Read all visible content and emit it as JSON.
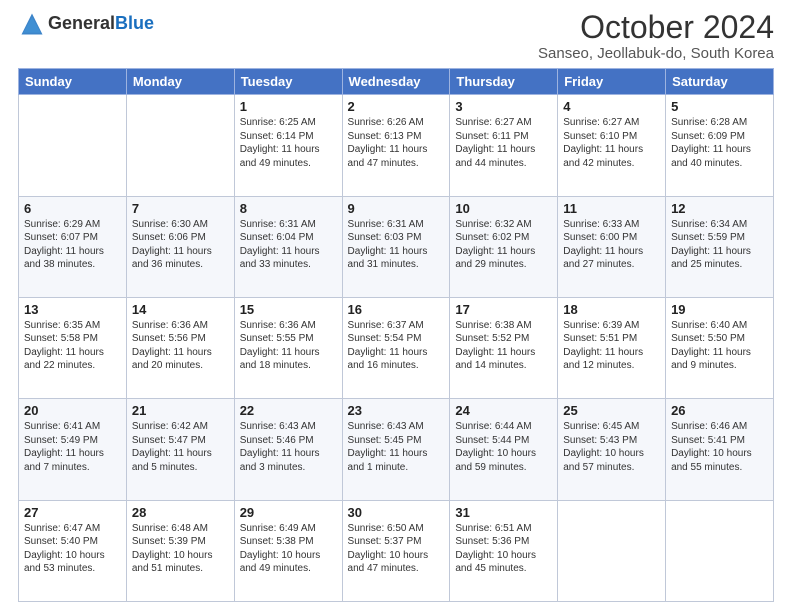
{
  "header": {
    "logo_line1": "General",
    "logo_line2": "Blue",
    "title": "October 2024",
    "subtitle": "Sanseo, Jeollabuk-do, South Korea"
  },
  "weekdays": [
    "Sunday",
    "Monday",
    "Tuesday",
    "Wednesday",
    "Thursday",
    "Friday",
    "Saturday"
  ],
  "weeks": [
    [
      {
        "day": "",
        "info": ""
      },
      {
        "day": "",
        "info": ""
      },
      {
        "day": "1",
        "info": "Sunrise: 6:25 AM\nSunset: 6:14 PM\nDaylight: 11 hours and 49 minutes."
      },
      {
        "day": "2",
        "info": "Sunrise: 6:26 AM\nSunset: 6:13 PM\nDaylight: 11 hours and 47 minutes."
      },
      {
        "day": "3",
        "info": "Sunrise: 6:27 AM\nSunset: 6:11 PM\nDaylight: 11 hours and 44 minutes."
      },
      {
        "day": "4",
        "info": "Sunrise: 6:27 AM\nSunset: 6:10 PM\nDaylight: 11 hours and 42 minutes."
      },
      {
        "day": "5",
        "info": "Sunrise: 6:28 AM\nSunset: 6:09 PM\nDaylight: 11 hours and 40 minutes."
      }
    ],
    [
      {
        "day": "6",
        "info": "Sunrise: 6:29 AM\nSunset: 6:07 PM\nDaylight: 11 hours and 38 minutes."
      },
      {
        "day": "7",
        "info": "Sunrise: 6:30 AM\nSunset: 6:06 PM\nDaylight: 11 hours and 36 minutes."
      },
      {
        "day": "8",
        "info": "Sunrise: 6:31 AM\nSunset: 6:04 PM\nDaylight: 11 hours and 33 minutes."
      },
      {
        "day": "9",
        "info": "Sunrise: 6:31 AM\nSunset: 6:03 PM\nDaylight: 11 hours and 31 minutes."
      },
      {
        "day": "10",
        "info": "Sunrise: 6:32 AM\nSunset: 6:02 PM\nDaylight: 11 hours and 29 minutes."
      },
      {
        "day": "11",
        "info": "Sunrise: 6:33 AM\nSunset: 6:00 PM\nDaylight: 11 hours and 27 minutes."
      },
      {
        "day": "12",
        "info": "Sunrise: 6:34 AM\nSunset: 5:59 PM\nDaylight: 11 hours and 25 minutes."
      }
    ],
    [
      {
        "day": "13",
        "info": "Sunrise: 6:35 AM\nSunset: 5:58 PM\nDaylight: 11 hours and 22 minutes."
      },
      {
        "day": "14",
        "info": "Sunrise: 6:36 AM\nSunset: 5:56 PM\nDaylight: 11 hours and 20 minutes."
      },
      {
        "day": "15",
        "info": "Sunrise: 6:36 AM\nSunset: 5:55 PM\nDaylight: 11 hours and 18 minutes."
      },
      {
        "day": "16",
        "info": "Sunrise: 6:37 AM\nSunset: 5:54 PM\nDaylight: 11 hours and 16 minutes."
      },
      {
        "day": "17",
        "info": "Sunrise: 6:38 AM\nSunset: 5:52 PM\nDaylight: 11 hours and 14 minutes."
      },
      {
        "day": "18",
        "info": "Sunrise: 6:39 AM\nSunset: 5:51 PM\nDaylight: 11 hours and 12 minutes."
      },
      {
        "day": "19",
        "info": "Sunrise: 6:40 AM\nSunset: 5:50 PM\nDaylight: 11 hours and 9 minutes."
      }
    ],
    [
      {
        "day": "20",
        "info": "Sunrise: 6:41 AM\nSunset: 5:49 PM\nDaylight: 11 hours and 7 minutes."
      },
      {
        "day": "21",
        "info": "Sunrise: 6:42 AM\nSunset: 5:47 PM\nDaylight: 11 hours and 5 minutes."
      },
      {
        "day": "22",
        "info": "Sunrise: 6:43 AM\nSunset: 5:46 PM\nDaylight: 11 hours and 3 minutes."
      },
      {
        "day": "23",
        "info": "Sunrise: 6:43 AM\nSunset: 5:45 PM\nDaylight: 11 hours and 1 minute."
      },
      {
        "day": "24",
        "info": "Sunrise: 6:44 AM\nSunset: 5:44 PM\nDaylight: 10 hours and 59 minutes."
      },
      {
        "day": "25",
        "info": "Sunrise: 6:45 AM\nSunset: 5:43 PM\nDaylight: 10 hours and 57 minutes."
      },
      {
        "day": "26",
        "info": "Sunrise: 6:46 AM\nSunset: 5:41 PM\nDaylight: 10 hours and 55 minutes."
      }
    ],
    [
      {
        "day": "27",
        "info": "Sunrise: 6:47 AM\nSunset: 5:40 PM\nDaylight: 10 hours and 53 minutes."
      },
      {
        "day": "28",
        "info": "Sunrise: 6:48 AM\nSunset: 5:39 PM\nDaylight: 10 hours and 51 minutes."
      },
      {
        "day": "29",
        "info": "Sunrise: 6:49 AM\nSunset: 5:38 PM\nDaylight: 10 hours and 49 minutes."
      },
      {
        "day": "30",
        "info": "Sunrise: 6:50 AM\nSunset: 5:37 PM\nDaylight: 10 hours and 47 minutes."
      },
      {
        "day": "31",
        "info": "Sunrise: 6:51 AM\nSunset: 5:36 PM\nDaylight: 10 hours and 45 minutes."
      },
      {
        "day": "",
        "info": ""
      },
      {
        "day": "",
        "info": ""
      }
    ]
  ]
}
